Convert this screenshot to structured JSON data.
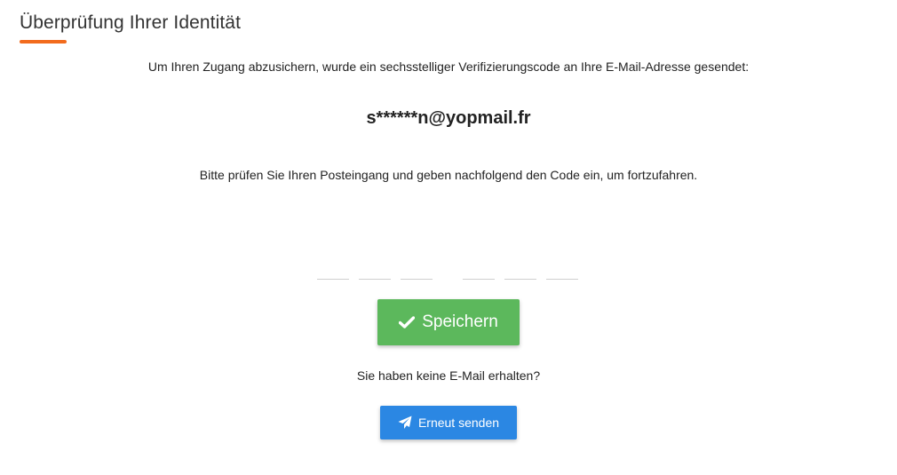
{
  "header": {
    "title": "Überprüfung Ihrer Identität"
  },
  "main": {
    "intro": "Um Ihren Zugang abzusichern, wurde ein sechsstelliger Verifizierungscode an Ihre E-Mail-Adresse gesendet:",
    "masked_email": "s******n@yopmail.fr",
    "instruction": "Bitte prüfen Sie Ihren Posteingang und geben nachfolgend den Code ein, um fortzufahren.",
    "code_digits": [
      "",
      "",
      "",
      "",
      "",
      ""
    ],
    "save_label": "Speichern",
    "save_icon": "check-icon",
    "no_email_prompt": "Sie haben keine E-Mail erhalten?",
    "resend_label": "Erneut senden",
    "resend_icon": "paper-plane-icon"
  },
  "colors": {
    "accent": "#f26b1d",
    "save_button": "#5cb85c",
    "resend_button": "#2b87e3"
  }
}
